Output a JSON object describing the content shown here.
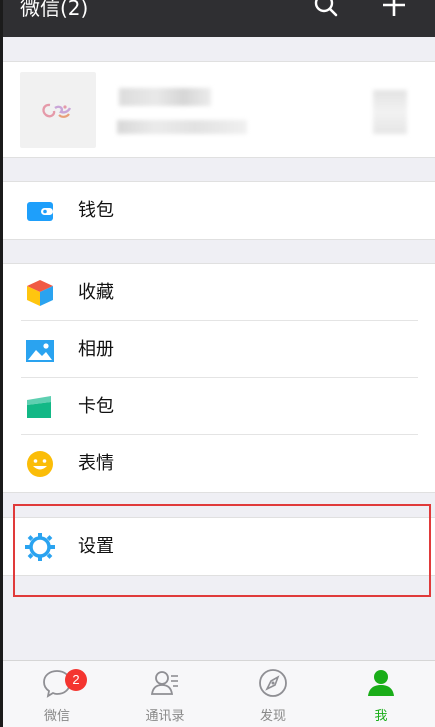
{
  "header": {
    "title": "微信(2)",
    "search_icon": "search-icon",
    "add_icon": "plus-icon"
  },
  "profile": {
    "avatar_icon": "avatar"
  },
  "menu": {
    "wallet": {
      "label": "钱包",
      "icon": "wallet-icon",
      "color": "#1e9ffb"
    },
    "favorites": {
      "label": "收藏",
      "icon": "favorites-cube-icon"
    },
    "album": {
      "label": "相册",
      "icon": "album-icon",
      "color": "#2aa3f0"
    },
    "cards": {
      "label": "卡包",
      "icon": "card-icon",
      "color": "#1fc08b"
    },
    "stickers": {
      "label": "表情",
      "icon": "smiley-icon",
      "color": "#fbbd08"
    },
    "settings": {
      "label": "设置",
      "icon": "gear-icon",
      "color": "#2aa3f0"
    }
  },
  "tabs": [
    {
      "label": "微信",
      "icon": "chat-icon",
      "badge": "2",
      "active": false
    },
    {
      "label": "通讯录",
      "icon": "contacts-icon",
      "active": false
    },
    {
      "label": "发现",
      "icon": "compass-icon",
      "active": false
    },
    {
      "label": "我",
      "icon": "person-icon",
      "active": true
    }
  ],
  "colors": {
    "header_bg": "#2f2f32",
    "active_tab": "#1aad19",
    "highlight": "#e03a3a",
    "badge": "#f43530"
  }
}
